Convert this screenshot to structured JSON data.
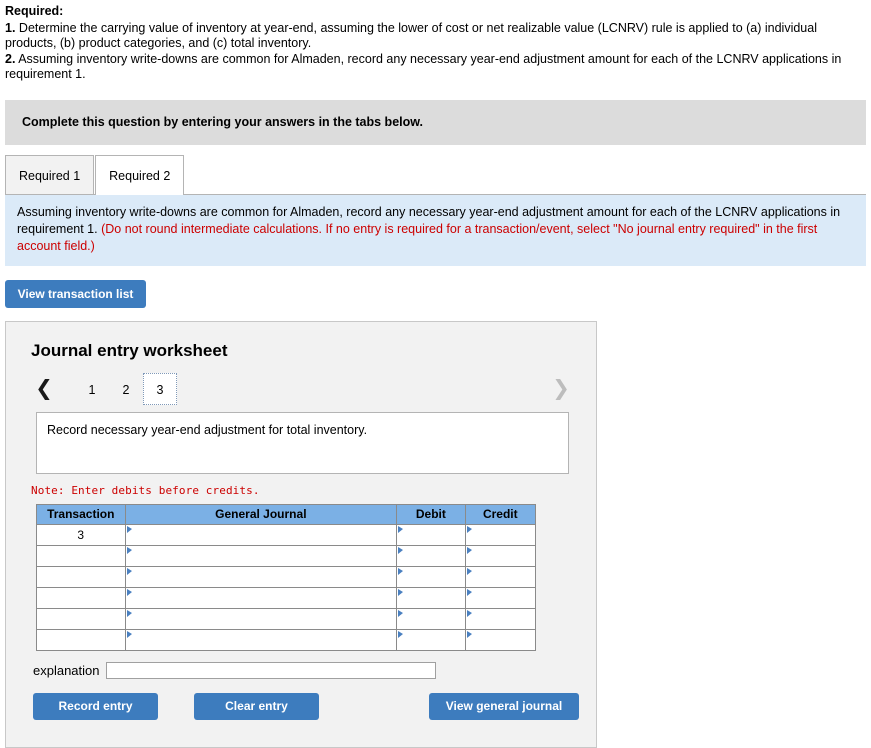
{
  "required": {
    "title": "Required:",
    "items": [
      {
        "num": "1.",
        "text": " Determine the carrying value of inventory at year-end, assuming the lower of cost or net realizable value (LCNRV) rule is applied to (a) individual products, (b) product categories, and (c) total inventory."
      },
      {
        "num": "2.",
        "text": " Assuming inventory write-downs are common for Almaden, record any necessary year-end adjustment amount for each of the LCNRV applications in requirement 1."
      }
    ]
  },
  "banner": {
    "text": "Complete this question by entering your answers in the tabs below."
  },
  "tabs": [
    {
      "label": "Required 1",
      "active": false
    },
    {
      "label": "Required 2",
      "active": true
    }
  ],
  "instruction": {
    "black_text": "Assuming inventory write-downs are common for Almaden, record any necessary year-end adjustment amount for each of the LCNRV applications in requirement 1. ",
    "red_text": "(Do not round intermediate calculations. If no entry is required for a transaction/event, select \"No journal entry required\" in the first account field.)"
  },
  "view_transaction_button": {
    "label": "View transaction list"
  },
  "worksheet": {
    "title": "Journal entry worksheet",
    "pager": {
      "prev_icon": "chevron-left",
      "next_icon": "chevron-right",
      "pages": [
        "1",
        "2",
        "3"
      ],
      "active_page": "3"
    },
    "entry_description": "Record necessary year-end adjustment for total inventory.",
    "note": "Note: Enter debits before credits.",
    "table": {
      "headers": [
        "Transaction",
        "General Journal",
        "Debit",
        "Credit"
      ],
      "rows": [
        {
          "transaction": "3",
          "general_journal": "",
          "debit": "",
          "credit": ""
        },
        {
          "transaction": "",
          "general_journal": "",
          "debit": "",
          "credit": ""
        },
        {
          "transaction": "",
          "general_journal": "",
          "debit": "",
          "credit": ""
        },
        {
          "transaction": "",
          "general_journal": "",
          "debit": "",
          "credit": ""
        },
        {
          "transaction": "",
          "general_journal": "",
          "debit": "",
          "credit": ""
        },
        {
          "transaction": "",
          "general_journal": "",
          "debit": "",
          "credit": ""
        }
      ]
    },
    "explanation": {
      "label": "explanation",
      "value": "",
      "placeholder": ""
    },
    "buttons": {
      "record": "Record entry",
      "clear": "Clear entry",
      "view_general_journal": "View general journal"
    }
  },
  "colors": {
    "primary_blue": "#3d7cbe",
    "table_header_blue": "#7bb0e5",
    "instruction_bg": "#dbeaf8",
    "banner_gray": "#dcdcdc",
    "note_red": "#cc0000",
    "panel_gray": "#f2f2f2"
  }
}
